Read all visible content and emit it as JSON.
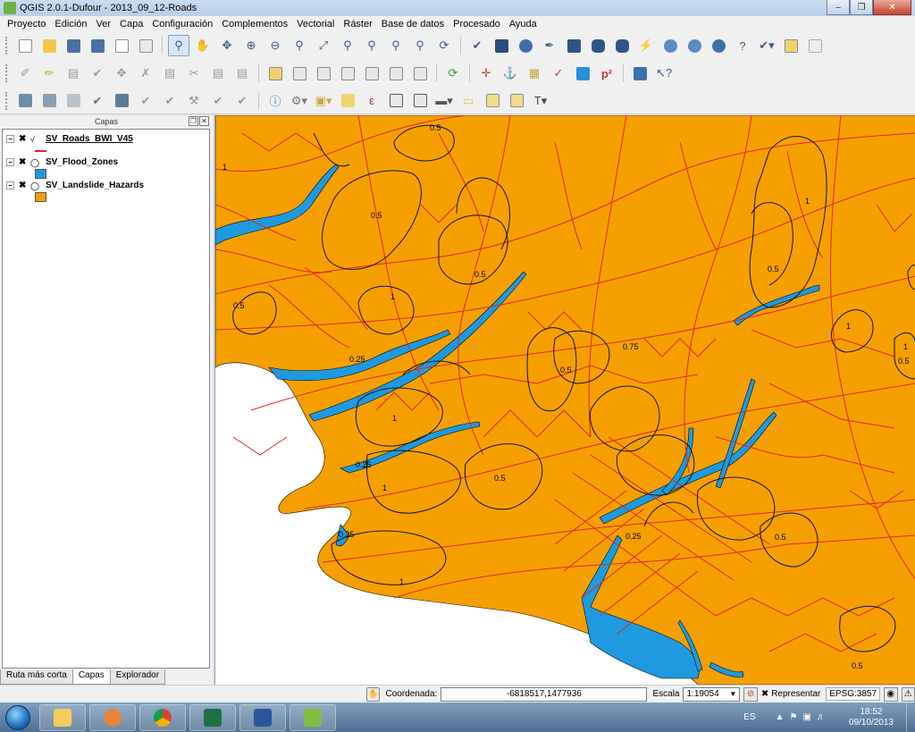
{
  "window": {
    "title": "QGIS 2.0.1-Dufour - 2013_09_12-Roads"
  },
  "menu": [
    "Proyecto",
    "Edición",
    "Ver",
    "Capa",
    "Configuración",
    "Complementos",
    "Vectorial",
    "Ráster",
    "Base de datos",
    "Procesado",
    "Ayuda"
  ],
  "layers_panel": {
    "title": "Capas",
    "layers": [
      {
        "name": "SV_Roads_BWI_V45",
        "checked": true,
        "legend": "line",
        "color": "#e2261c"
      },
      {
        "name": "SV_Flood_Zones",
        "checked": true,
        "legend": "fill",
        "color": "#1e9ae0"
      },
      {
        "name": "SV_Landslide_Hazards",
        "checked": true,
        "legend": "fill",
        "color": "#f59e0b"
      }
    ],
    "tabs": [
      "Ruta más corta",
      "Capas",
      "Explorador"
    ]
  },
  "map": {
    "background_color": "#ffffff",
    "land_color": "#f5a000",
    "flood_color": "#1e9ae0",
    "road_color": "#e2261c",
    "zone_labels": [
      "0.5",
      "1",
      "0.5",
      "0.5",
      "1",
      "0.5",
      "1",
      "0.25",
      "0.75",
      "0.5",
      "1",
      "1",
      "0.5",
      "0.25",
      "1",
      "0.5",
      "0.25",
      "0.5",
      "1",
      "0.25",
      "0.5",
      "0.5",
      "1"
    ]
  },
  "status": {
    "coord_label": "Coordenada:",
    "coord_value": "-6818517,1477936",
    "scale_label": "Escala",
    "scale_value": "1:19054",
    "render_label": "Representar",
    "crs": "EPSG:3857"
  },
  "taskbar": {
    "language": "ES",
    "time": "18:52",
    "date": "09/10/2013"
  }
}
